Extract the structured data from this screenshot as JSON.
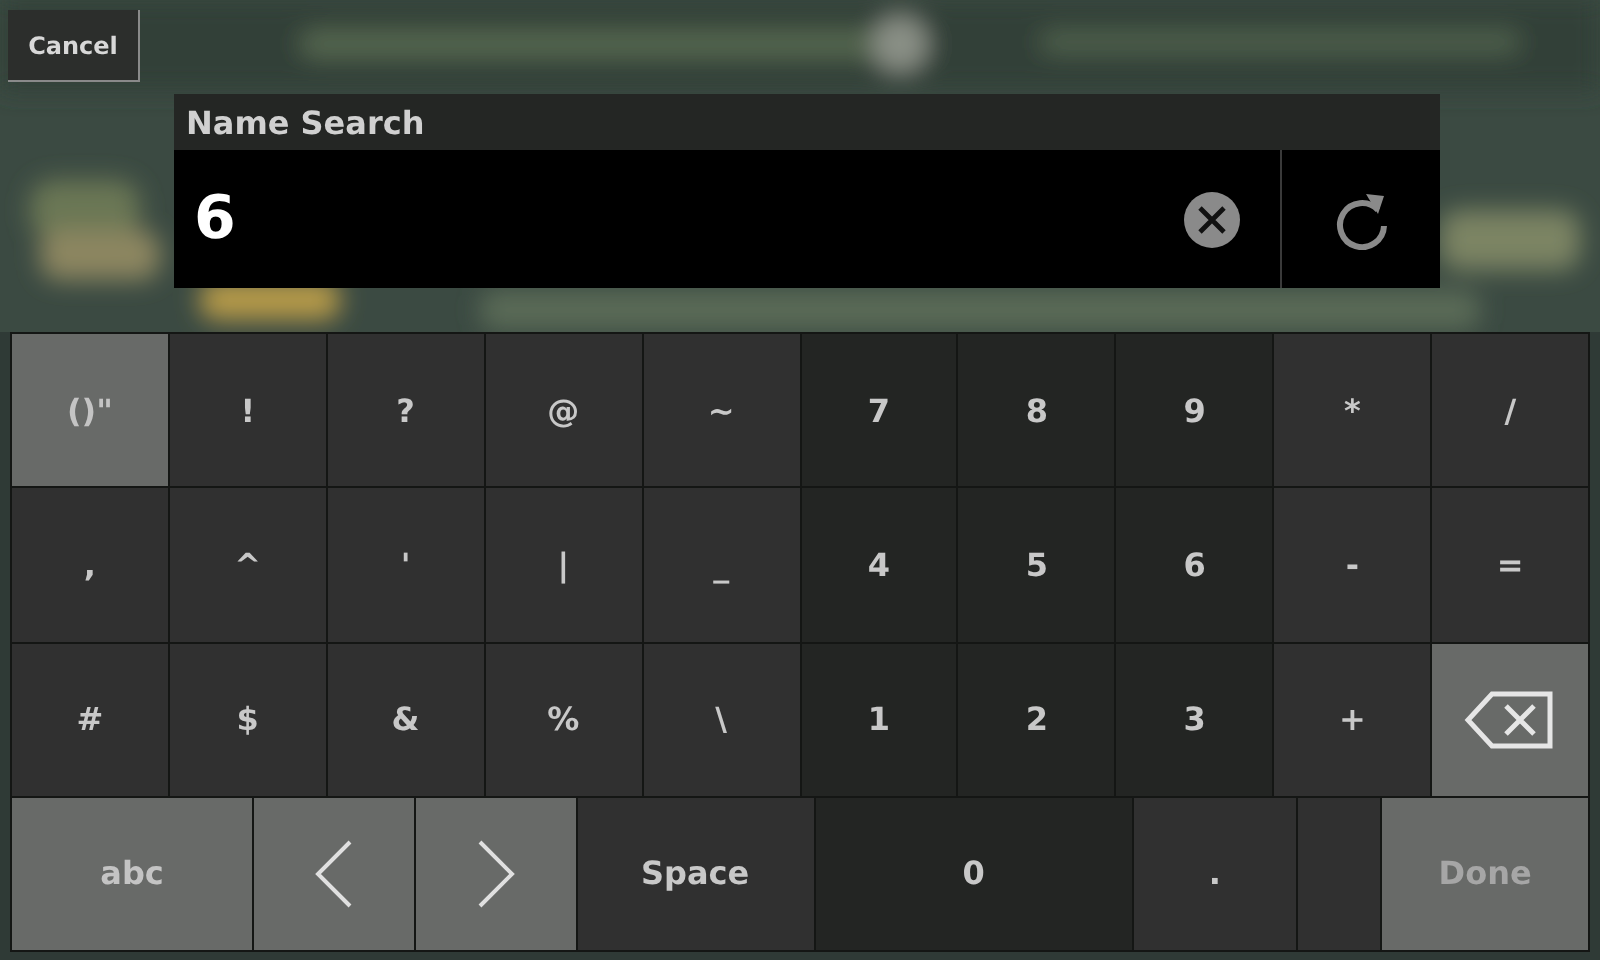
{
  "cancel_button": {
    "label": "Cancel"
  },
  "search_panel": {
    "title": "Name Search",
    "value": "6"
  },
  "keyboard": {
    "rows": [
      [
        {
          "label": "()\"",
          "kind": "mode"
        },
        {
          "label": "!",
          "kind": "symbol"
        },
        {
          "label": "?",
          "kind": "symbol"
        },
        {
          "label": "@",
          "kind": "symbol"
        },
        {
          "label": "~",
          "kind": "symbol"
        },
        {
          "label": "7",
          "kind": "digit"
        },
        {
          "label": "8",
          "kind": "digit"
        },
        {
          "label": "9",
          "kind": "digit"
        },
        {
          "label": "*",
          "kind": "symbol"
        },
        {
          "label": "/",
          "kind": "symbol"
        }
      ],
      [
        {
          "label": ",",
          "kind": "symbol"
        },
        {
          "label": "^",
          "kind": "symbol"
        },
        {
          "label": "'",
          "kind": "symbol"
        },
        {
          "label": "|",
          "kind": "symbol"
        },
        {
          "label": "_",
          "kind": "symbol"
        },
        {
          "label": "4",
          "kind": "digit"
        },
        {
          "label": "5",
          "kind": "digit"
        },
        {
          "label": "6",
          "kind": "digit"
        },
        {
          "label": "-",
          "kind": "symbol"
        },
        {
          "label": "=",
          "kind": "symbol"
        }
      ],
      [
        {
          "label": "#",
          "kind": "symbol"
        },
        {
          "label": "$",
          "kind": "symbol"
        },
        {
          "label": "&",
          "kind": "symbol"
        },
        {
          "label": "%",
          "kind": "symbol"
        },
        {
          "label": "\\",
          "kind": "symbol"
        },
        {
          "label": "1",
          "kind": "digit"
        },
        {
          "label": "2",
          "kind": "digit"
        },
        {
          "label": "3",
          "kind": "digit"
        },
        {
          "label": "+",
          "kind": "symbol"
        },
        {
          "kind": "backspace"
        }
      ]
    ],
    "bottom_row": [
      {
        "label": "abc",
        "kind": "mode"
      },
      {
        "kind": "left"
      },
      {
        "kind": "right"
      },
      {
        "label": "Space",
        "kind": "symbol"
      },
      {
        "label": "0",
        "kind": "digit"
      },
      {
        "label": ".",
        "kind": "symbol"
      },
      {
        "kind": "blank"
      },
      {
        "label": "Done",
        "kind": "done"
      }
    ]
  }
}
